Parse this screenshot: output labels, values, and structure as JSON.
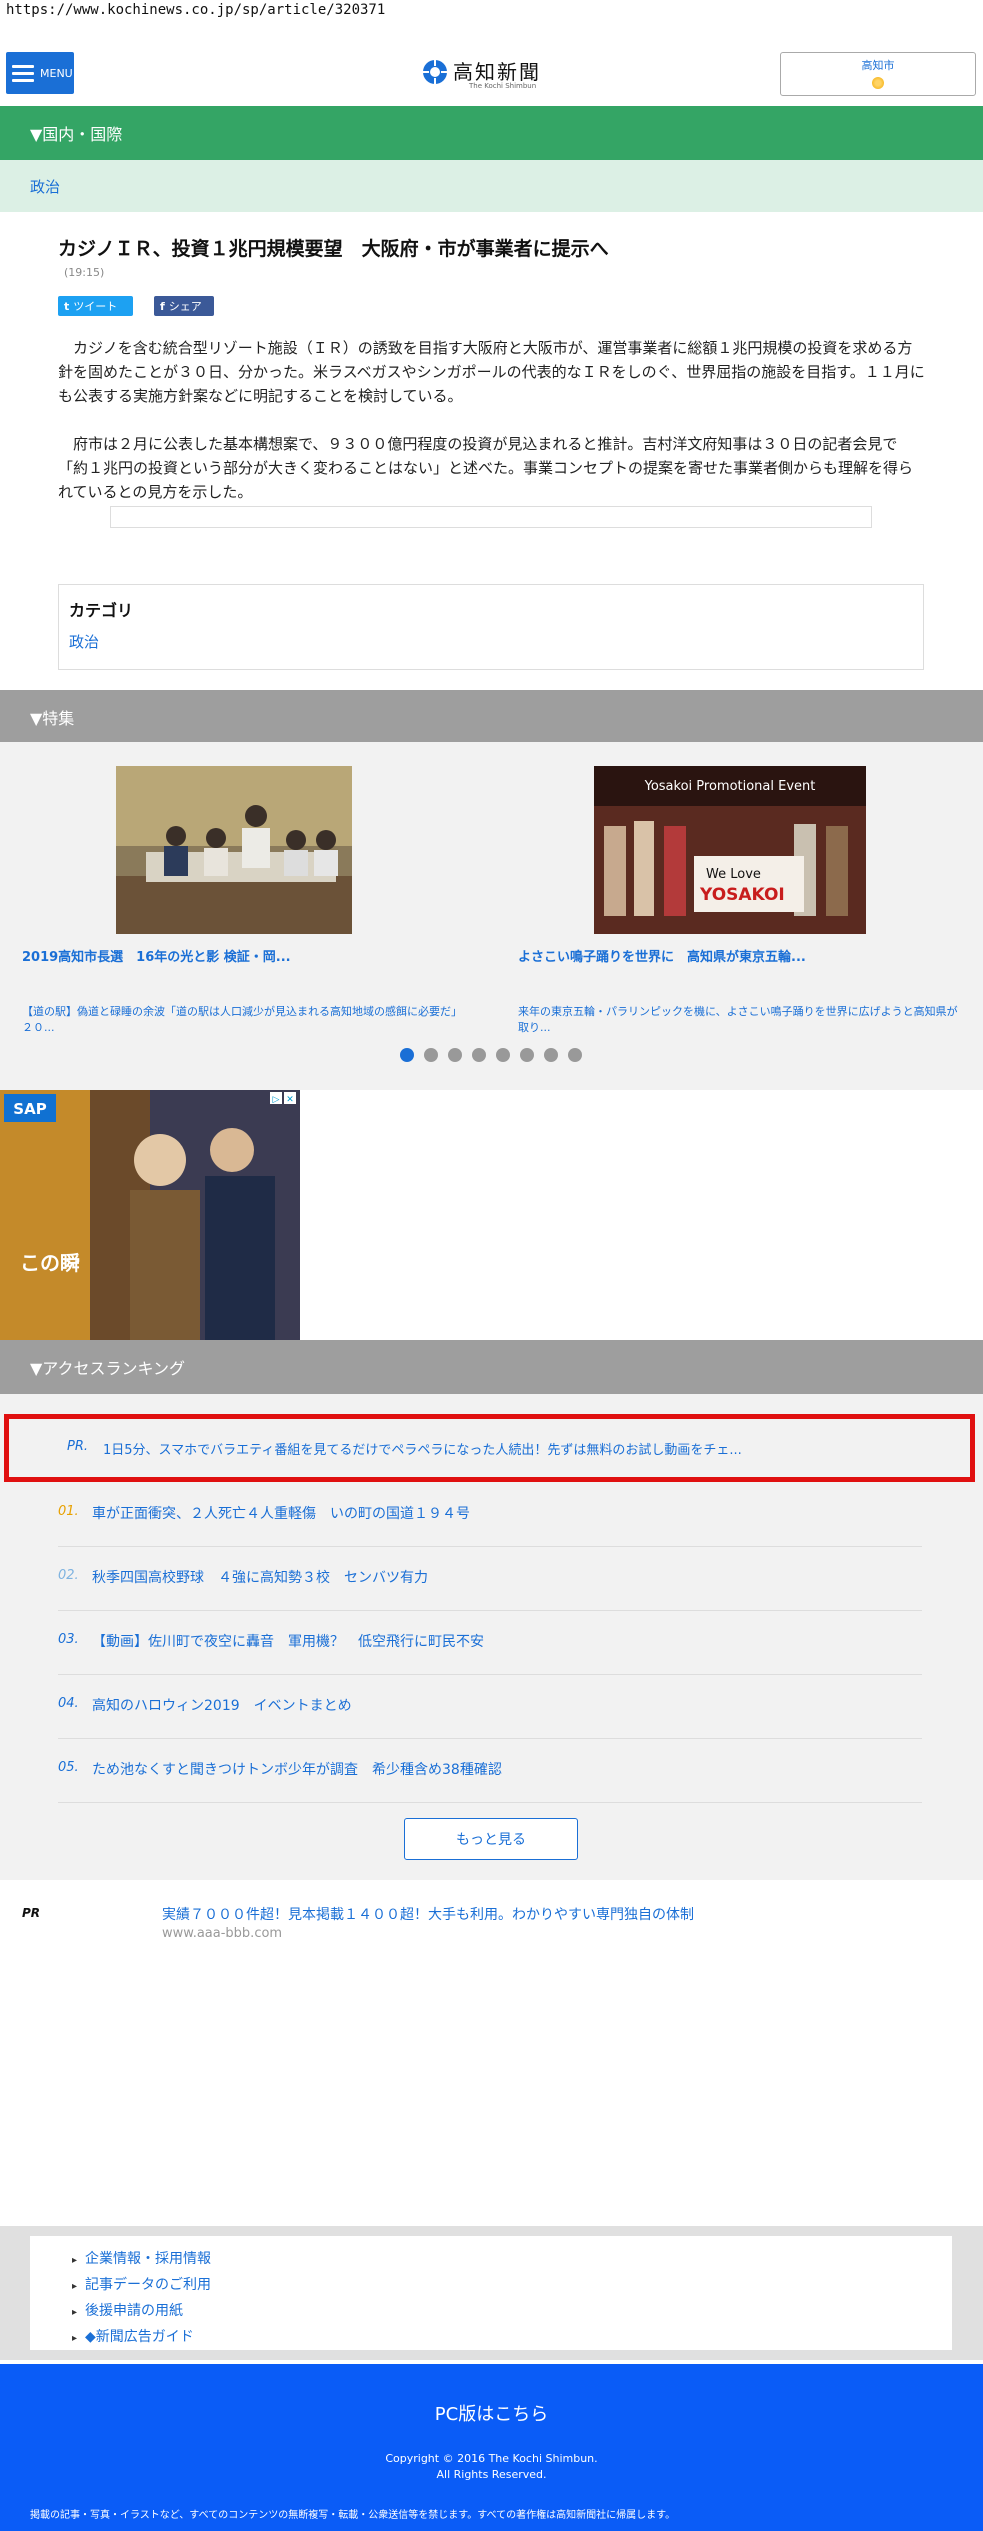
{
  "url": "https://www.kochinews.co.jp/sp/article/320371",
  "header": {
    "menu_label": "MENU",
    "logo_text": "高知新聞",
    "logo_sub": "The Kochi Shimbun",
    "weather_city": "高知市"
  },
  "section": {
    "label": "▼国内・国際"
  },
  "subcategory": {
    "label": "政治"
  },
  "article": {
    "title": "カジノＩＲ、投資１兆円規模要望　大阪府・市が事業者に提示へ",
    "time": "(19:15)",
    "tweet_label": "ツイート",
    "share_label": "シェア",
    "paragraph1": "カジノを含む統合型リゾート施設（ＩＲ）の誘致を目指す大阪府と大阪市が、運営事業者に総額１兆円規模の投資を求める方針を固めたことが３０日、分かった。米ラスベガスやシンガポールの代表的なＩＲをしのぐ、世界屈指の施設を目指す。１１月にも公表する実施方針案などに明記することを検討している。",
    "paragraph2": "府市は２月に公表した基本構想案で、９３００億円程度の投資が見込まれると推計。吉村洋文府知事は３０日の記者会見で「約１兆円の投資という部分が大きく変わることはない」と述べた。事業コンセプトの提案を寄せた事業者側からも理解を得られているとの見方を示した。"
  },
  "category_box": {
    "title": "カテゴリ",
    "link": "政治"
  },
  "feature": {
    "label": "▼特集",
    "items": [
      {
        "title": "2019高知市長選　16年の光と影 検証・岡...",
        "desc": "【道の駅】偽道と碌睡の余波「道の駅は人口減少が見込まれる高知地域の感餌に必要だ」２０..."
      },
      {
        "title": "よさこい鳴子踊りを世界に　高知県が東京五輪...",
        "desc": "来年の東京五輪・パラリンピックを機に、よさこい鳴子踊りを世界に広げようと高知県が取り..."
      }
    ],
    "banner_text1": "Yosakoi Promotional Event",
    "banner_text2": "We Love",
    "banner_text3": "YOSAKOI",
    "dots_count": 8,
    "active_dot": 0
  },
  "ad": {
    "brand": "SAP",
    "caption": "この瞬"
  },
  "ranking": {
    "label": "▼アクセスランキング",
    "pr_label": "PR.",
    "pr_text": "1日5分、スマホでバラエティ番組を見てるだけでペラペラになった人続出！先ずは無料のお試し動画をチェ...",
    "items": [
      {
        "num": "01.",
        "text": "車が正面衝突、２人死亡４人重軽傷　いの町の国道１９４号",
        "color": "#e8a100"
      },
      {
        "num": "02.",
        "text": "秋季四国高校野球　４強に高知勢３校　センバツ有力",
        "color": "#7fb3e0"
      },
      {
        "num": "03.",
        "text": "【動画】佐川町で夜空に轟音　軍用機？　低空飛行に町民不安",
        "color": "#1a6fd6"
      },
      {
        "num": "04.",
        "text": "高知のハロウィン2019　イベントまとめ",
        "color": "#1a6fd6"
      },
      {
        "num": "05.",
        "text": "ため池なくすと聞きつけトンボ少年が調査　希少種含め38種確認",
        "color": "#1a6fd6"
      }
    ],
    "more_label": "もっと見る"
  },
  "pr2": {
    "label": "PR",
    "text": "実績７０００件超！見本掲載１４００超！大手も利用。わかりやすい専門独自の体制",
    "url": "www.aaa-bbb.com"
  },
  "footer": {
    "links": [
      "企業情報・採用情報",
      "記事データのご利用",
      "後援申請の用紙",
      "◆新聞広告ガイド"
    ],
    "pc_link": "PC版はこちら",
    "copyright1": "Copyright © 2016 The Kochi Shimbun.",
    "copyright2": "All Rights Reserved.",
    "notice": "掲載の記事・写真・イラストなど、すべてのコンテンツの無断複写・転載・公衆送信等を禁じます。すべての著作権は高知新聞社に帰属します。"
  }
}
